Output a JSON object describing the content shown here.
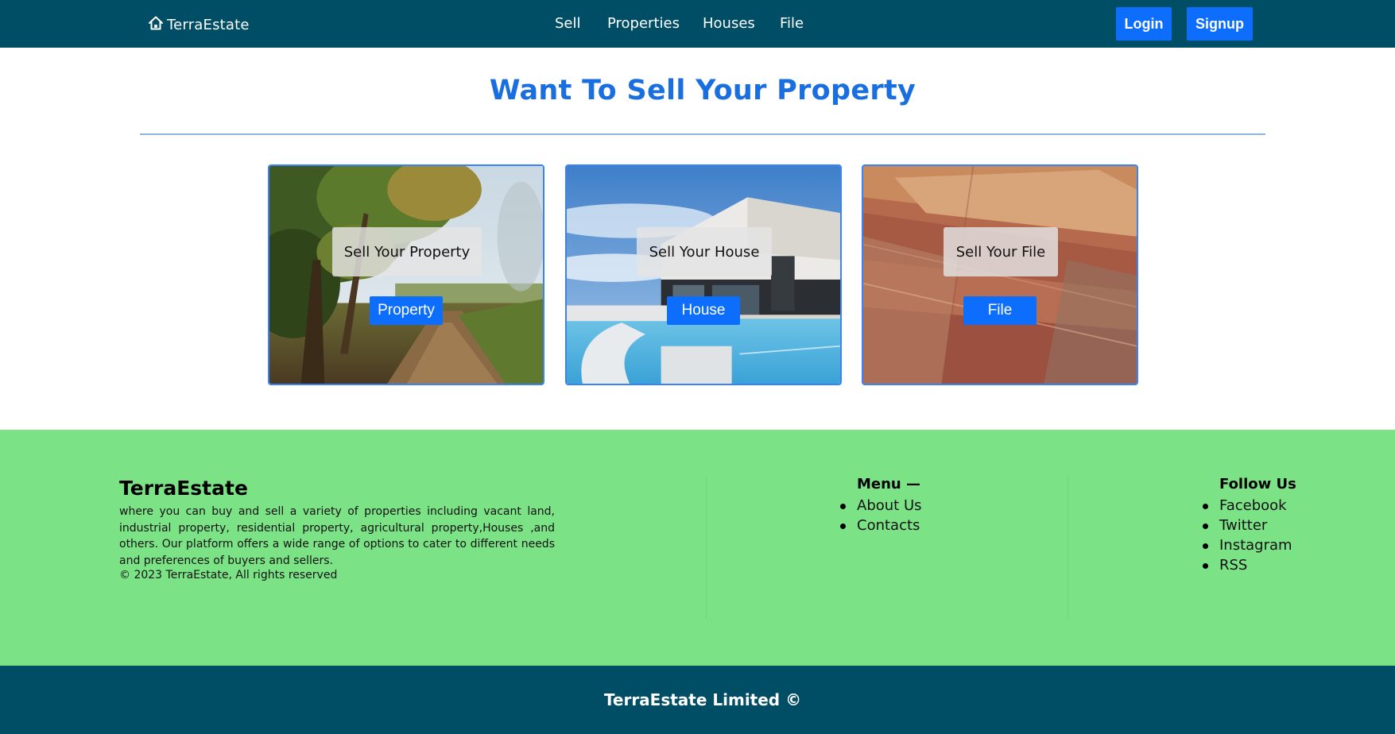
{
  "navbar": {
    "brand": "TerraEstate",
    "links": [
      "Sell",
      "Properties",
      "Houses",
      "File"
    ],
    "login_label": "Login",
    "signup_label": "Signup"
  },
  "hero": {
    "title": "Want To Sell Your Property"
  },
  "cards": [
    {
      "label": "Sell Your Property",
      "button": "Property"
    },
    {
      "label": "Sell Your House",
      "button": "House"
    },
    {
      "label": "Sell Your File",
      "button": "File"
    }
  ],
  "footer": {
    "brand": "TerraEstate",
    "description": "where you can buy and sell a variety of properties including vacant land, industrial property, residential property, agricultural property,Houses ,and others. Our platform offers a wide range of options to cater to different needs and preferences of buyers and sellers.",
    "copyright": "© 2023 TerraEstate, All rights reserved",
    "menu_title": "Menu —",
    "menu_items": [
      "About Us",
      "Contacts"
    ],
    "follow_title": "Follow Us",
    "follow_items": [
      "Facebook",
      "Twitter",
      "Instagram",
      "RSS"
    ]
  },
  "bottom_bar": {
    "text": "TerraEstate Limited ©"
  },
  "colors": {
    "nav_bg": "#004d66",
    "accent_blue": "#0d6efd",
    "title_blue": "#1a6fe0",
    "footer_green": "#7be386"
  }
}
